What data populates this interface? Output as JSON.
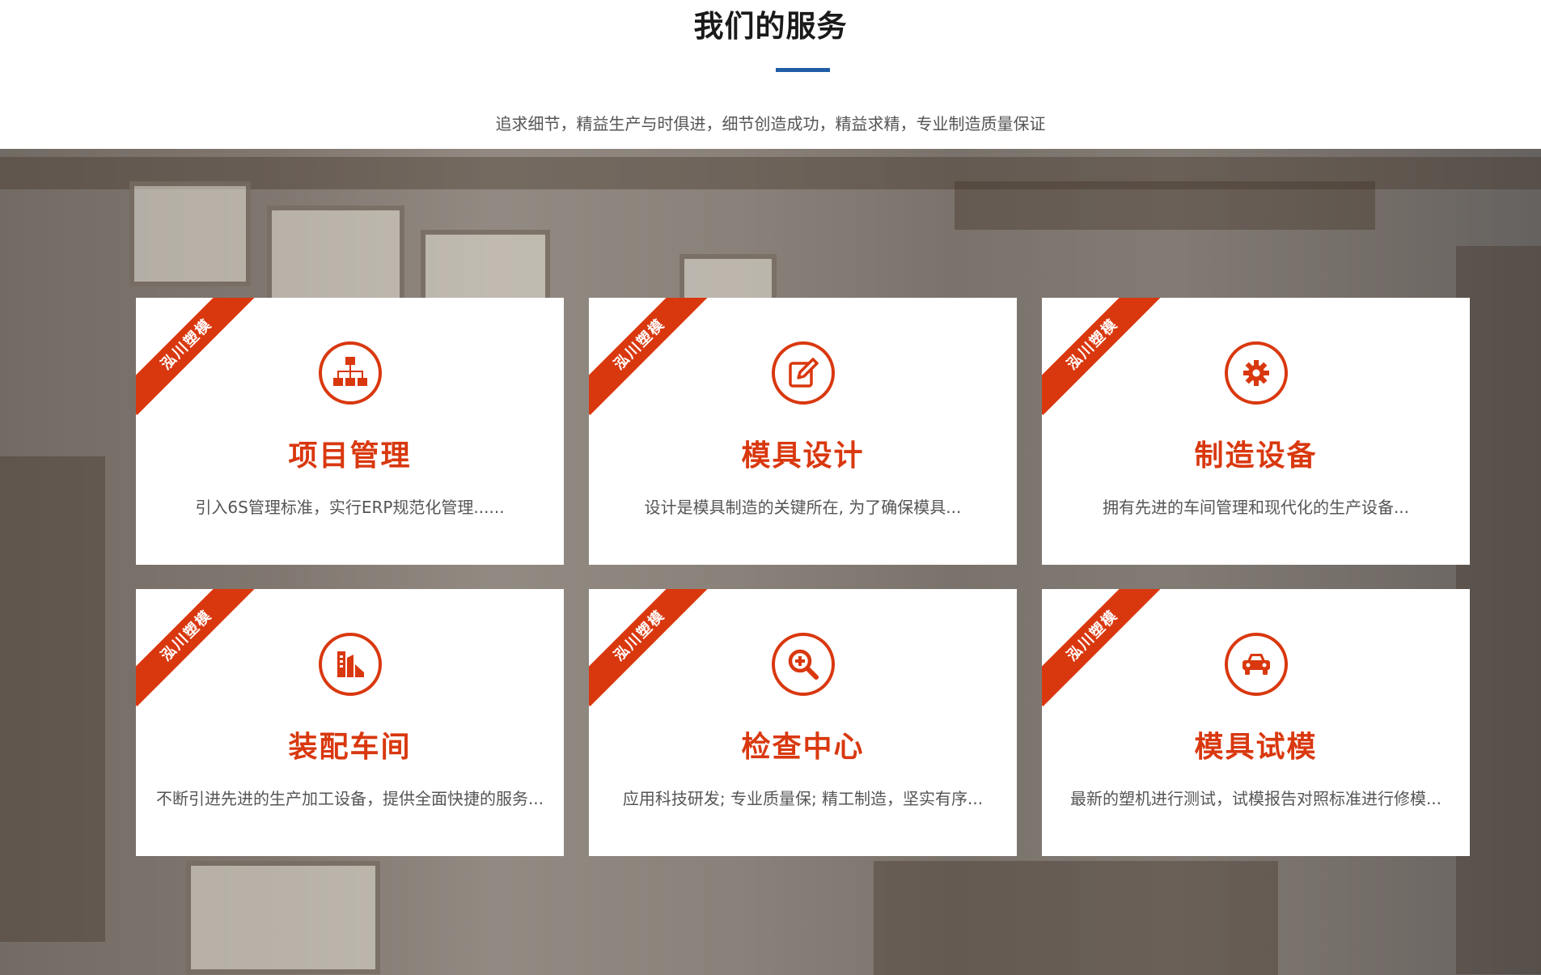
{
  "section": {
    "title": "我们的服务",
    "subtitle": "追求细节，精益生产与时俱进，细节创造成功，精益求精，专业制造质量保证"
  },
  "accent_color": "#d9380f",
  "title_bar_color": "#1f5da6",
  "ribbon_text": "泓川塑模",
  "services": [
    {
      "title": "项目管理",
      "desc": "引入6S管理标准，实行ERP规范化管理......",
      "icon": "sitemap-icon"
    },
    {
      "title": "模具设计",
      "desc": "设计是模具制造的关键所在, 为了确保模具...",
      "icon": "edit-icon"
    },
    {
      "title": "制造设备",
      "desc": "拥有先进的车间管理和现代化的生产设备...",
      "icon": "gear-icon"
    },
    {
      "title": "装配车间",
      "desc": "不断引进先进的生产加工设备，提供全面快捷的服务...",
      "icon": "layers-icon"
    },
    {
      "title": "检查中心",
      "desc": "应用科技研发; 专业质量保; 精工制造，坚实有序...",
      "icon": "search-plus-icon"
    },
    {
      "title": "模具试模",
      "desc": "最新的塑机进行测试，试模报告对照标准进行修模...",
      "icon": "car-icon"
    }
  ]
}
